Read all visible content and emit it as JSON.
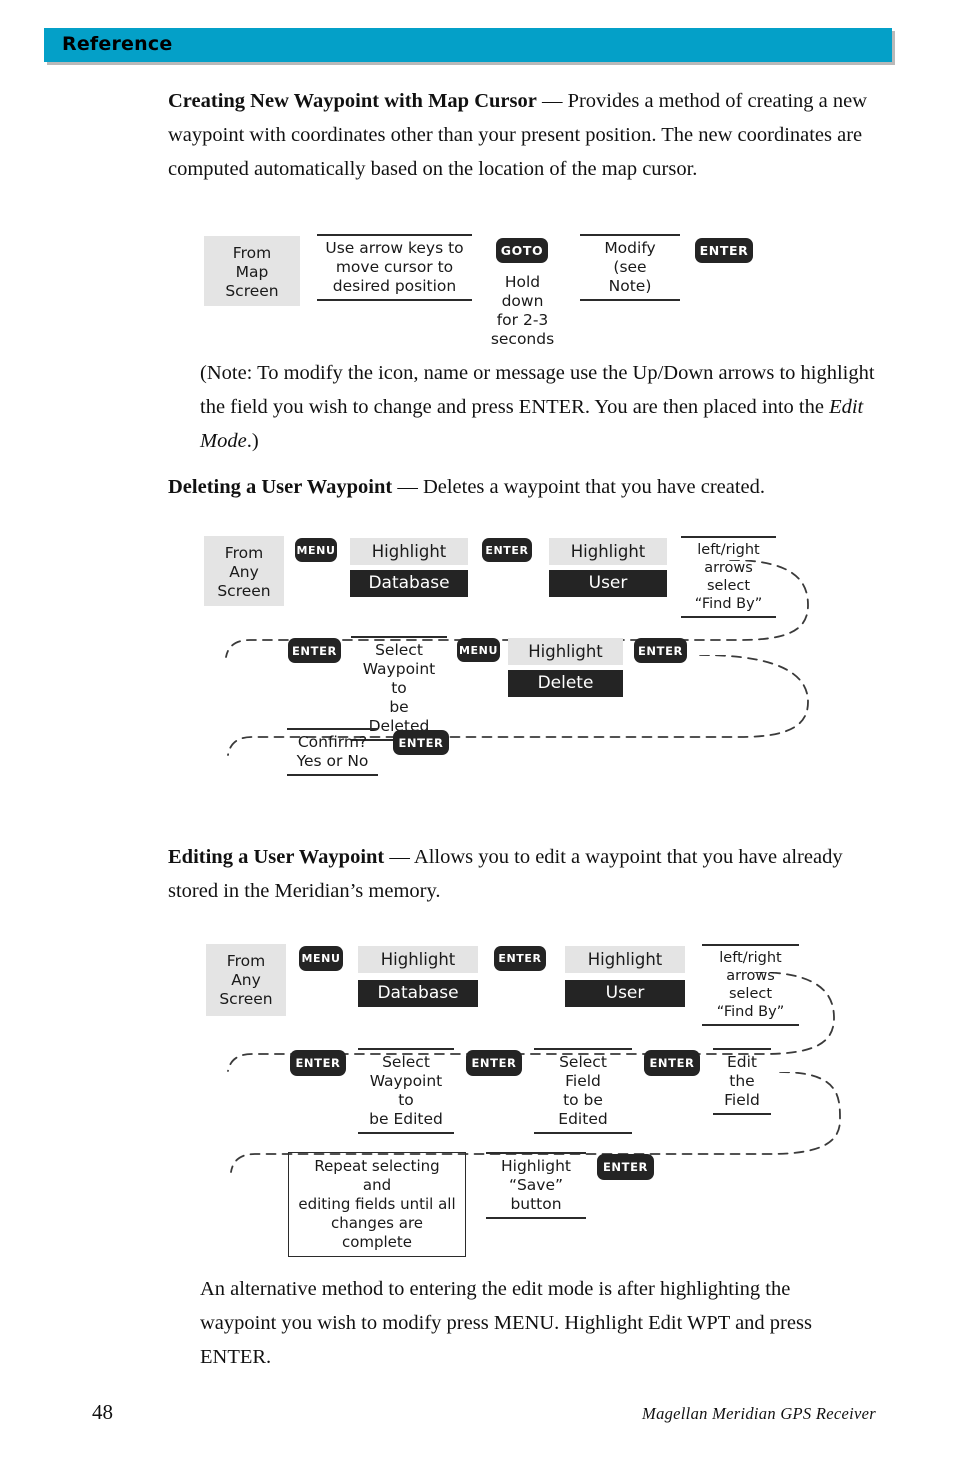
{
  "page": {
    "header_title": "Reference",
    "header_color": "#04a0c8",
    "footer_page_number": "48",
    "footer_note": "Magellan Meridian GPS Receiver"
  },
  "sections": {
    "creating": {
      "heading": "Creating New Waypoint with Map Cursor",
      "dash": " — ",
      "body": "Provides a method of creating a new waypoint with coordinates other than your present position.  The new coordinates are computed automatically based on the location of the map cursor."
    },
    "note": {
      "text_before": "(Note:  To modify the icon, name or message use the Up/Down arrows to highlight the field you wish to change and press ENTER.  You are then placed into the ",
      "italic": "Edit Mode",
      "text_after": ".)"
    },
    "deleting": {
      "heading": "Deleting a User Waypoint",
      "dash": " — ",
      "body": "Deletes a waypoint that you have created."
    },
    "editing": {
      "heading": "Editing a User Waypoint",
      "dash": " — ",
      "body": "Allows you to edit a waypoint that you have already stored in the Meridian’s memory."
    },
    "alternative": {
      "text": "An alternative method to entering the edit mode is after highlighting the waypoint you wish to modify press MENU.  Highlight Edit WPT and press ENTER."
    }
  },
  "flow_create": {
    "n1": "From\nMap\nScreen",
    "n2": "Use arrow keys to\nmove cursor to\ndesired position",
    "key_goto": "GOTO",
    "n3": "Hold down\nfor 2-3\nseconds",
    "n4": "Modify\n(see\nNote)",
    "key_enter": "ENTER"
  },
  "flow_delete": {
    "row1": {
      "n1": "From\nAny\nScreen",
      "key_menu": "MENU",
      "n2_top": "Highlight",
      "n2_bottom": "Database",
      "key_enter": "ENTER",
      "n3_top": "Highlight",
      "n3_bottom": "User",
      "n4": "left/right\narrows select\n“Find By”"
    },
    "row2": {
      "key_enter_1": "ENTER",
      "n1": "Select\nWaypoint to\nbe Deleted",
      "key_menu": "MENU",
      "n2_top": "Highlight",
      "n2_bottom": "Delete",
      "key_enter_2": "ENTER"
    },
    "row3": {
      "n1": "Confirm?\nYes or No",
      "key_enter": "ENTER"
    }
  },
  "flow_edit": {
    "row1": {
      "n1": "From\nAny\nScreen",
      "key_menu": "MENU",
      "n2_top": "Highlight",
      "n2_bottom": "Database",
      "key_enter": "ENTER",
      "n3_top": "Highlight",
      "n3_bottom": "User",
      "n4": "left/right\narrows select\n“Find By”"
    },
    "row2": {
      "key_enter_1": "ENTER",
      "n1": "Select\nWaypoint to\nbe Edited",
      "key_enter_2": "ENTER",
      "n2": "Select Field\nto be\nEdited",
      "key_enter_3": "ENTER",
      "n3": "Edit\nthe\nField"
    },
    "row3": {
      "n1": "Repeat selecting and\nediting fields until all\nchanges are complete",
      "n2": "Highlight\n“Save”\nbutton",
      "key_enter": "ENTER"
    }
  }
}
